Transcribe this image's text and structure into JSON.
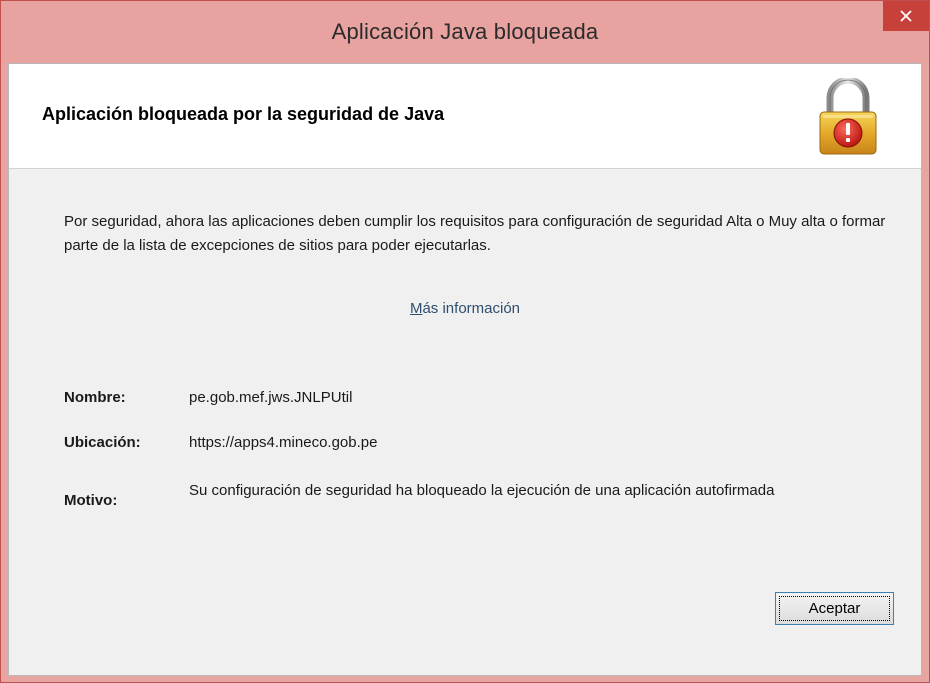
{
  "window": {
    "title": "Aplicación Java bloqueada",
    "close_label": "×"
  },
  "header": {
    "title": "Aplicación bloqueada por la seguridad de Java",
    "icon": "lock-warning-icon"
  },
  "message": {
    "text": "Por seguridad, ahora las aplicaciones deben cumplir los requisitos para configuración de seguridad Alta o Muy alta o formar parte de la lista de excepciones de sitios para poder ejecutarlas.",
    "more_info_first": "M",
    "more_info_rest": "ás información"
  },
  "details": {
    "name_label": "Nombre:",
    "name_value": "pe.gob.mef.jws.JNLPUtil",
    "location_label": "Ubicación:",
    "location_value": "https://apps4.mineco.gob.pe",
    "reason_label": "Motivo:",
    "reason_value": "Su configuración de seguridad ha bloqueado la ejecución de una aplicación autofirmada"
  },
  "buttons": {
    "ok_label": "Aceptar"
  },
  "colors": {
    "titlebar": "#e8a29f",
    "close": "#c7403a",
    "link": "#2f4f6f"
  }
}
